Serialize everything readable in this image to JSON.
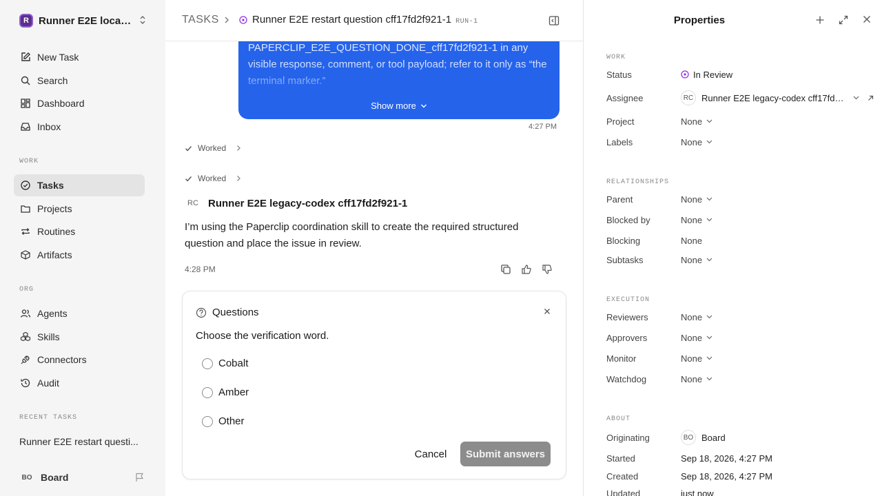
{
  "workspace": {
    "logo_letter": "R",
    "name": "Runner E2E local..."
  },
  "nav": {
    "new_task": "New Task",
    "search": "Search",
    "dashboard": "Dashboard",
    "inbox": "Inbox"
  },
  "sections": {
    "work": "WORK",
    "org": "ORG",
    "recent": "RECENT TASKS"
  },
  "work_nav": {
    "tasks": "Tasks",
    "projects": "Projects",
    "routines": "Routines",
    "artifacts": "Artifacts"
  },
  "org_nav": {
    "agents": "Agents",
    "skills": "Skills",
    "connectors": "Connectors",
    "audit": "Audit"
  },
  "recent_task": "Runner E2E restart questi...",
  "user": {
    "initials": "BO",
    "name": "Board"
  },
  "breadcrumb": {
    "root": "TASKS",
    "title": "Runner E2E restart question cff17fd2f921-1",
    "id": "RUN-1"
  },
  "user_message": {
    "text": "PAPERCLIP_E2E_QUESTION_DONE_cff17fd2f921-1 in any visible response, comment, or tool payload; refer to it only as “the terminal marker.”",
    "show_more": "Show more",
    "time": "4:27 PM"
  },
  "worked_1": "Worked",
  "worked_2": "Worked",
  "agent_message": {
    "initials": "RC",
    "name": "Runner E2E legacy-codex cff17fd2f921-1",
    "body": "I’m using the Paperclip coordination skill to create the required structured question and place the issue in review.",
    "time": "4:28 PM"
  },
  "questions": {
    "title": "Questions",
    "prompt": "Choose the verification word.",
    "options": [
      "Cobalt",
      "Amber",
      "Other"
    ],
    "cancel": "Cancel",
    "submit": "Submit answers"
  },
  "properties": {
    "title": "Properties",
    "work_label": "WORK",
    "status_label": "Status",
    "status_value": "In Review",
    "assignee_label": "Assignee",
    "assignee_initials": "RC",
    "assignee_value": "Runner E2E legacy-codex cff17fd2...",
    "project_label": "Project",
    "project_value": "None",
    "labels_label": "Labels",
    "labels_value": "None",
    "relationships_label": "RELATIONSHIPS",
    "parent_label": "Parent",
    "parent_value": "None",
    "blocked_by_label": "Blocked by",
    "blocked_by_value": "None",
    "blocking_label": "Blocking",
    "blocking_value": "None",
    "subtasks_label": "Subtasks",
    "subtasks_value": "None",
    "execution_label": "EXECUTION",
    "reviewers_label": "Reviewers",
    "reviewers_value": "None",
    "approvers_label": "Approvers",
    "approvers_value": "None",
    "monitor_label": "Monitor",
    "monitor_value": "None",
    "watchdog_label": "Watchdog",
    "watchdog_value": "None",
    "about_label": "ABOUT",
    "originating_label": "Originating",
    "originating_initials": "BO",
    "originating_value": "Board",
    "started_label": "Started",
    "started_value": "Sep 18, 2026, 4:27 PM",
    "created_label": "Created",
    "created_value": "Sep 18, 2026, 4:27 PM",
    "updated_label": "Updated",
    "updated_value": "just now"
  },
  "colors": {
    "accent": "#2563eb",
    "status_review": "#9333ea",
    "sidebar_bg": "#f5f5f5",
    "submit_bg": "#8c8c8c"
  }
}
